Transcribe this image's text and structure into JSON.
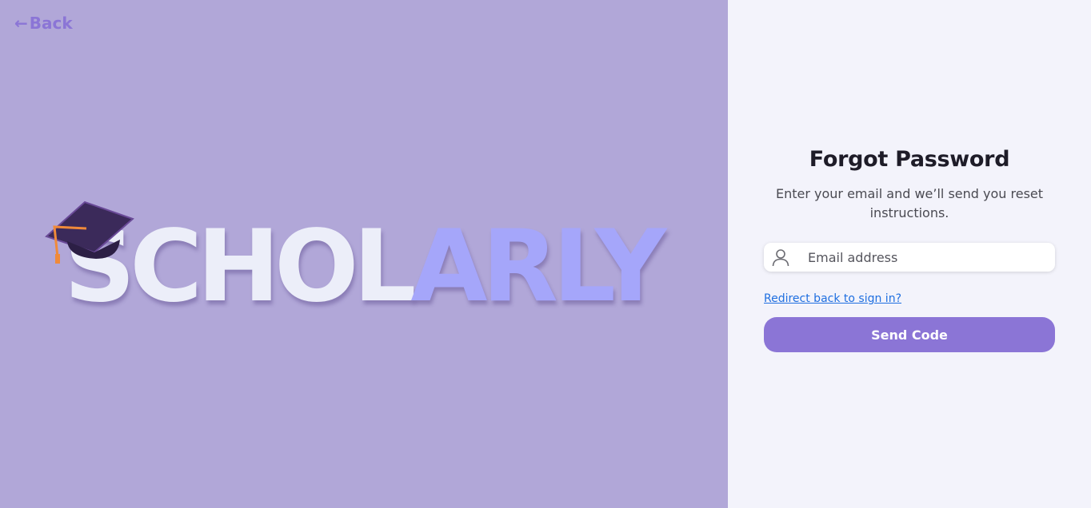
{
  "nav": {
    "back_arrow": "←",
    "back_label": "Back"
  },
  "logo": {
    "text_part_1": "SCHOL",
    "text_part_2": "ARLY",
    "icon": "graduation-cap-icon",
    "colors": {
      "part_1": "#eceef9",
      "part_2": "#a5a6fa",
      "cap": "#3b2a5a",
      "tassel": "#f08a3a"
    }
  },
  "form": {
    "title": "Forgot Password",
    "subtitle": "Enter your email and we’ll send you reset instructions.",
    "email": {
      "icon": "user-icon",
      "placeholder": "Email address",
      "value": ""
    },
    "redirect_label": "Redirect back to sign in?",
    "submit_label": "Send Code"
  },
  "colors": {
    "left_background": "#b1a7d8",
    "right_background": "#f3f3fb",
    "accent": "#8b75d6",
    "link": "#1f6fe0"
  }
}
